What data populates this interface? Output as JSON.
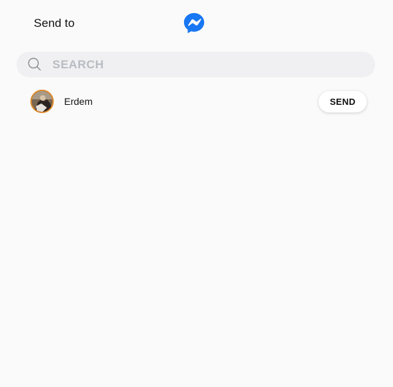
{
  "header": {
    "title": "Send to",
    "logo_icon": "messenger-icon",
    "logo_color": "#1877f2"
  },
  "search": {
    "placeholder": "SEARCH",
    "value": "",
    "icon": "search-icon"
  },
  "contacts": [
    {
      "name": "Erdem",
      "avatar_ring_color": "#e08b2c",
      "action_label": "SEND"
    }
  ]
}
